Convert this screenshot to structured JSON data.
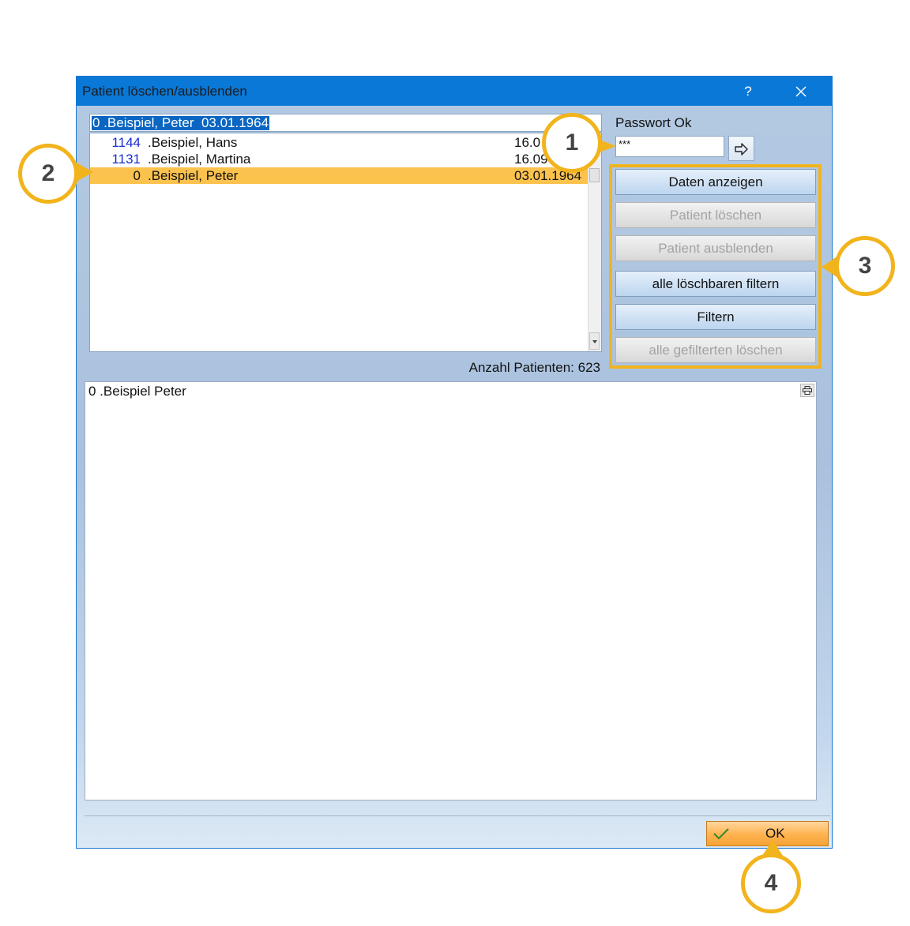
{
  "window": {
    "title": "Patient löschen/ausblenden",
    "help_label": "?"
  },
  "search": {
    "selected_value": "0 .Beispiel, Peter  03.01.1964"
  },
  "patients": [
    {
      "number": "1144",
      "name": ".Beispiel, Hans",
      "date": "16.0"
    },
    {
      "number": "1131",
      "name": ".Beispiel, Martina",
      "date": "16.09"
    },
    {
      "number": "0",
      "name": ".Beispiel, Peter",
      "date": "03.01.1964"
    }
  ],
  "count_label": "Anzahl Patienten: 623",
  "password": {
    "label": "Passwort Ok",
    "value": "***"
  },
  "actions": {
    "show_data": "Daten anzeigen",
    "delete_patient": "Patient löschen",
    "hide_patient": "Patient ausblenden",
    "filter_deletable": "alle löschbaren filtern",
    "filter": "Filtern",
    "delete_filtered": "alle gefilterten löschen"
  },
  "detail": {
    "text": "0 .Beispiel Peter"
  },
  "ok_label": "OK",
  "callouts": {
    "c1": "1",
    "c2": "2",
    "c3": "3",
    "c4": "4"
  },
  "colors": {
    "titlebar": "#0a78d7",
    "selection": "#fbc24e",
    "callout": "#f2b41c",
    "ok_button": "#ffb24d"
  }
}
